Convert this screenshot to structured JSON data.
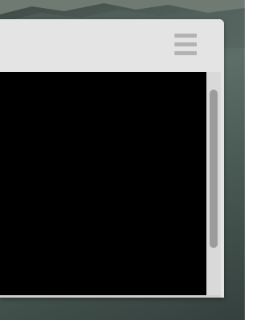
{
  "window": {
    "menu_icon": "hamburger-menu-icon"
  },
  "scroll": {
    "position_fraction": 0.27,
    "visible_fraction": 0.71
  },
  "colors": {
    "titlebar": "#e4e4e4",
    "content": "#000000",
    "scroll_track": "#d9d9d9",
    "scroll_thumb": "#9c9c9c"
  }
}
